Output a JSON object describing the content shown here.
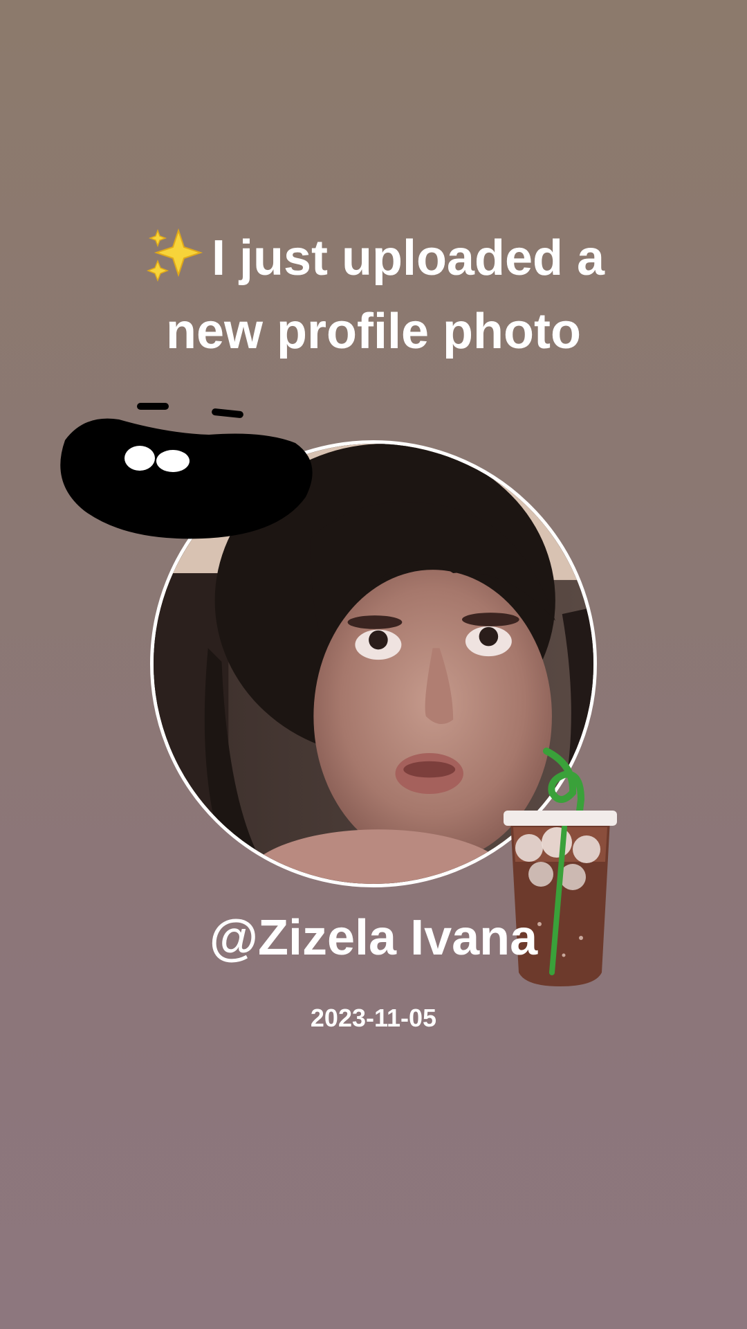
{
  "headline": {
    "line1": "I just uploaded a",
    "line2": "new profile photo",
    "emoji": "sparkles-icon"
  },
  "profile": {
    "username": "@Zizela Ivana",
    "date": "2023-11-05"
  },
  "stickers": [
    "smiling-mouth-sticker",
    "iced-coffee-sticker"
  ],
  "colors": {
    "background_top": "#8c7a6c",
    "background_bottom": "#8d777e",
    "text": "#ffffff",
    "avatar_ring": "#ffffff"
  }
}
